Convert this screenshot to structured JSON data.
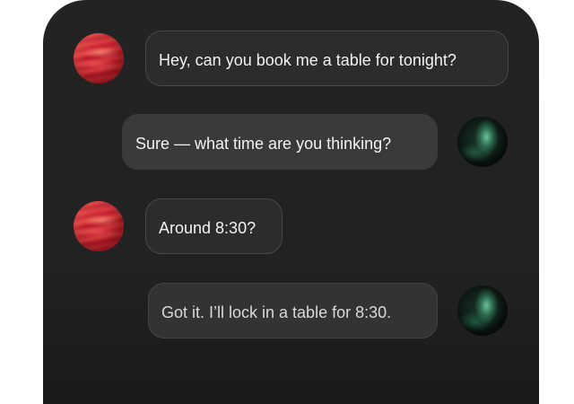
{
  "conversation": {
    "messages": [
      {
        "role": "user",
        "text": "Hey, can you book me a table for tonight?"
      },
      {
        "role": "assistant",
        "text": "Sure — what time are you thinking?"
      },
      {
        "role": "user",
        "text": "Around 8:30?"
      },
      {
        "role": "assistant",
        "text": "Got it. I’ll lock in a table for 8:30."
      }
    ]
  },
  "avatars": {
    "user_color": "#c62034",
    "assistant_color": "#1b3a2c"
  }
}
